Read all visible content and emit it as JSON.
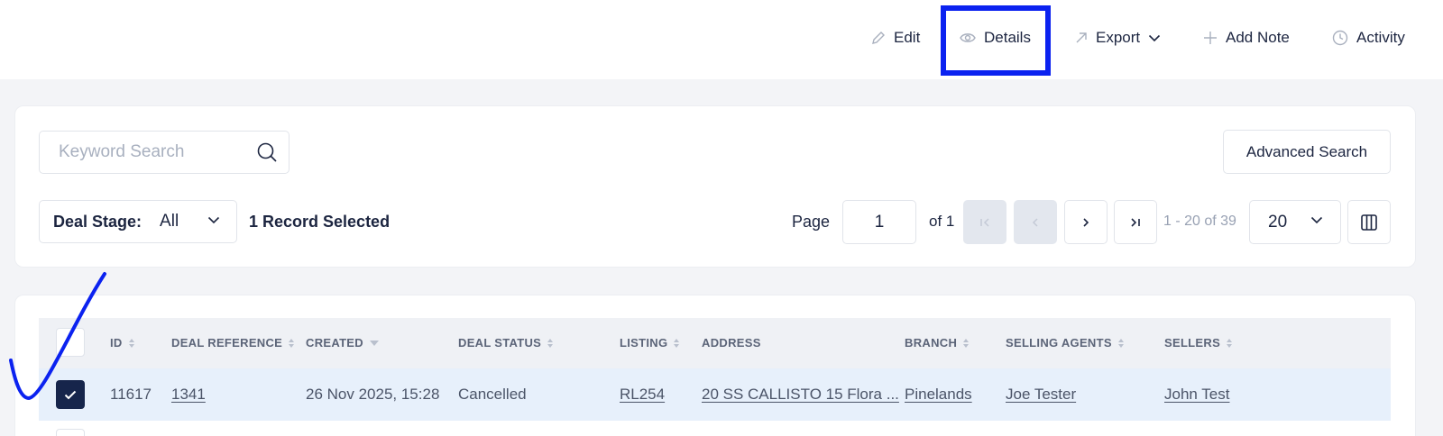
{
  "toolbar": {
    "edit_label": "Edit",
    "details_label": "Details",
    "export_label": "Export",
    "add_note_label": "Add Note",
    "activity_label": "Activity",
    "highlight_color": "#0b22f0"
  },
  "search": {
    "placeholder": "Keyword Search",
    "value": "",
    "advanced_label": "Advanced Search"
  },
  "filters": {
    "deal_stage_label": "Deal Stage:",
    "deal_stage_value": "All",
    "selection_status": "1 Record Selected"
  },
  "pagination": {
    "page_label": "Page",
    "current_page": "1",
    "of_label": "of 1",
    "range_text": "1 - 20 of 39",
    "page_size": "20"
  },
  "table": {
    "columns": [
      "ID",
      "DEAL REFERENCE",
      "CREATED",
      "DEAL STATUS",
      "LISTING",
      "ADDRESS",
      "BRANCH",
      "SELLING AGENTS",
      "SELLERS"
    ],
    "rows": [
      {
        "selected": true,
        "id": "11617",
        "deal_reference": "1341",
        "created": "26 Nov 2025, 15:28",
        "deal_status": "Cancelled",
        "listing": "RL254",
        "address": "20 SS CALLISTO 15 Flora ...",
        "branch": "Pinelands",
        "selling_agents": "Joe Tester",
        "sellers": "John Test"
      }
    ]
  },
  "colors": {
    "primary_dark": "#16254b",
    "selected_row": "#e7f0fb",
    "annotation": "#0b22f0"
  }
}
